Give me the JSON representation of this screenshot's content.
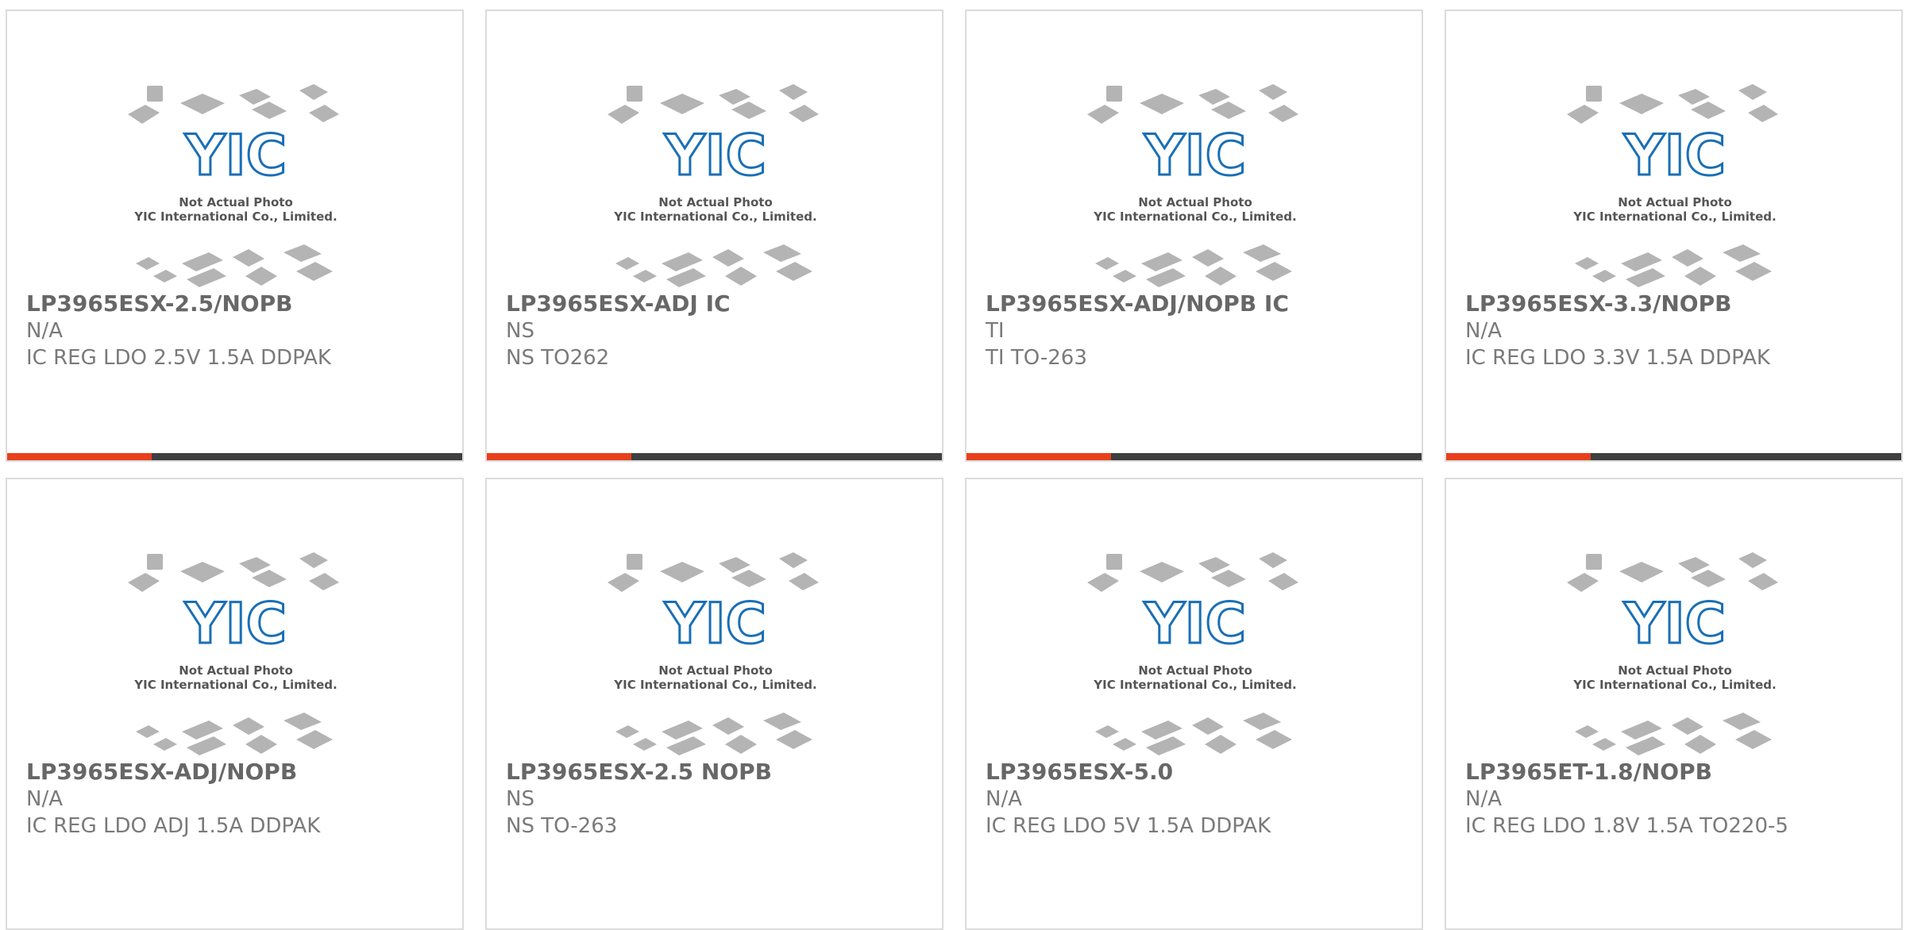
{
  "products": [
    {
      "part": "LP3965ESX-2.5/NOPB",
      "manufacturer": "N/A",
      "description": "IC REG LDO 2.5V 1.5A DDPAK"
    },
    {
      "part": "LP3965ESX-ADJ IC",
      "manufacturer": "NS",
      "description": "NS TO262"
    },
    {
      "part": "LP3965ESX-ADJ/NOPB IC",
      "manufacturer": "TI",
      "description": "TI TO-263"
    },
    {
      "part": "LP3965ESX-3.3/NOPB",
      "manufacturer": "N/A",
      "description": "IC REG LDO 3.3V 1.5A DDPAK"
    },
    {
      "part": "LP3965ESX-ADJ/NOPB",
      "manufacturer": "N/A",
      "description": "IC REG LDO ADJ 1.5A DDPAK"
    },
    {
      "part": "LP3965ESX-2.5 NOPB",
      "manufacturer": "NS",
      "description": "NS TO-263"
    },
    {
      "part": "LP3965ESX-5.0",
      "manufacturer": "N/A",
      "description": "IC REG LDO 5V 1.5A DDPAK"
    },
    {
      "part": "LP3965ET-1.8/NOPB",
      "manufacturer": "N/A",
      "description": "IC REG LDO 1.8V 1.5A TO220-5"
    }
  ],
  "placeholder": {
    "logo_text": "YIC",
    "line1": "Not Actual Photo",
    "line2": "YIC International Co., Limited.",
    "icon": "chip-packages-icon"
  },
  "colors": {
    "accent": "#e8401c",
    "bar": "#3f3f3f",
    "logo": "#1a6fb5",
    "text": "#676767"
  }
}
